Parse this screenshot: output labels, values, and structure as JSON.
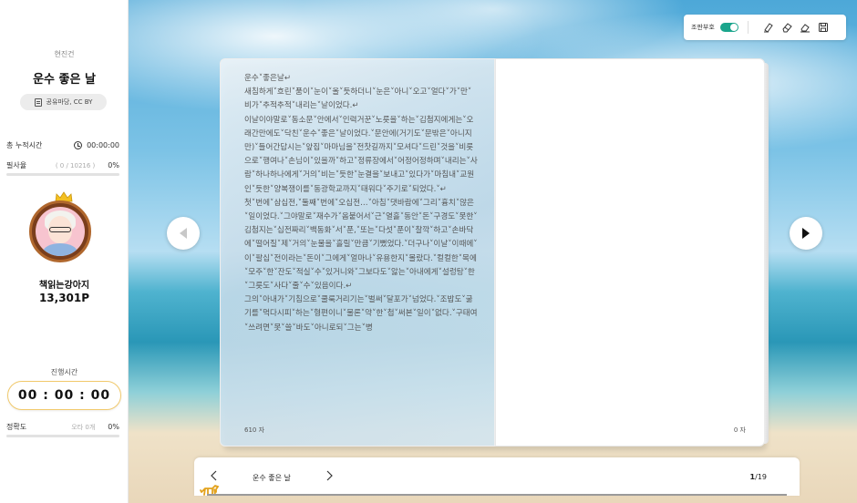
{
  "sidebar": {
    "kicker": "현진건",
    "book_title": "운수 좋은 날",
    "license": "공유마당, CC BY",
    "total_time_label": "총 누적시간",
    "total_time_value": "00:00:00",
    "typing_rate_label": "필사율",
    "typing_rate_count": "( 0 / 10216 )",
    "typing_rate_percent": "0%",
    "typing_rate_fraction": 0,
    "user_name": "책읽는강아지",
    "points": "13,301P",
    "progress_time_label": "진행시간",
    "progress_timer": "00 : 00 : 00",
    "accuracy_label": "정확도",
    "accuracy_errors": "오타 0개",
    "accuracy_percent": "0%",
    "accuracy_fraction": 0
  },
  "toolbar": {
    "toggle_label": "조판부호",
    "toggle_on": true,
    "tools": [
      "highlighter-icon",
      "eraser-icon",
      "clear-icon",
      "save-icon"
    ]
  },
  "book": {
    "left_text": "운수˅좋은날↵\n새침하게˅흐린˅품이˅눈이˅올˅듯하더니˅눈은˅아니˅오고˅얼다˅가˅만˅비가˅추적추적˅내리는˅날이었다.↵\n이날이야말로˅동소문˅안에서˅인력거꾼˅노릇을˅하는˅김첨지에게는˅오래간만에도˅닥친˅운수˅좋은˅날이었다.˅문안에(거기도˅문밖은˅아니지만)˅들어간답시는˅앞집˅마마님을˅전찻길까지˅모셔다˅드린˅것을˅비롯으로˅행여나˅손님이˅있을까˅하고˅정류장에서˅어정어정하며˅내리는˅사람˅하나하나에게˅거의˅비는˅듯한˅눈결을˅보내고˅있다가˅마침내˅교원인˅듯한˅양복쟁이를˅동광학교까지˅태워다˅주기로˅되었다.˅↵\n첫˅번에˅삼십전,˅둘째˅번에˅오십전…˅아침˅댓바람에˅그리˅흉치˅않은˅일이었다.˅그야말로˅재수가˅옴붙어서˅근˅열흘˅동안˅돈˅구경도˅못한˅김첨지는˅십전짜리˅백동화˅서˅푼,˅또는˅다섯˅푼이˅찰깍˅하고˅손바닥에˅떨어질˅제˅거의˅눈물을˅흘릴˅만큼˅기뻤었다.˅더구나˅이날˅이때에˅이˅팔십˅전이라는˅돈이˅그에게˅얼마나˅유용한지˅몰랐다.˅컬컬한˅목에˅모주˅한˅잔도˅적실˅수˅있거니와˅그보다도˅앓는˅아내에게˅설렁탕˅한˅그릇도˅사다˅줄˅수˅있음이다.↵\n그의˅아내가˅기침으로˅쿨룩거리기는˅벌써˅달포가˅넘었다.˅조밥도˅굶기를˅먹다시피˅하는˅형편이니˅물론˅약˅한˅첩˅써본˅일이˅없다.˅구태여˅쓰려면˅못˅쓸˅바도˅아니로되˅그는˅병",
    "left_count": "610 자",
    "right_count": "0 자"
  },
  "bottom_bar": {
    "chapter_title": "운수 좋은 날",
    "current_page": "1",
    "total_pages": "/19"
  }
}
